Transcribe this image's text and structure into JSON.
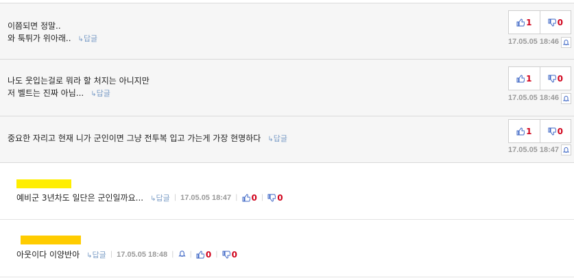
{
  "comments": [
    {
      "lines": [
        "이쯤되면 정말..",
        "와 툭튀가 위아래.."
      ],
      "reply_label": "답글",
      "up": "1",
      "down": "0",
      "date": "17.05.05 18:46"
    },
    {
      "lines": [
        "나도 웃입는걸로 뭐라 할 처지는 아니지만",
        "저 벨트는 진짜 아님..."
      ],
      "reply_label": "답글",
      "up": "1",
      "down": "0",
      "date": "17.05.05 18:46"
    },
    {
      "lines": [
        "중요한 자리고 현재 니가 군인이면 그냥 전투복 입고 가는게 가장 현명하다"
      ],
      "reply_label": "답글",
      "up": "1",
      "down": "0",
      "date": "17.05.05 18:47"
    }
  ],
  "replies": [
    {
      "text": "예비군 3년차도 일단은 군인일까요...",
      "reply_label": "답글",
      "date": "17.05.05 18:47",
      "up": "0",
      "down": "0",
      "name_color": "#ffee00"
    },
    {
      "text": "아웃이다 이양반아",
      "reply_label": "답글",
      "date": "17.05.05 18:48",
      "up": "0",
      "down": "0",
      "name_color": "#ffcc00"
    }
  ],
  "colors": {
    "thumb_up": "#3b64c4",
    "thumb_down": "#3b64c4",
    "count": "#d0021b",
    "reply_link": "#7a9cc6"
  },
  "icons": {
    "up": "thumbs-up-icon",
    "down": "thumbs-down-icon",
    "report": "bell-icon",
    "reply": "reply-arrow-icon"
  }
}
